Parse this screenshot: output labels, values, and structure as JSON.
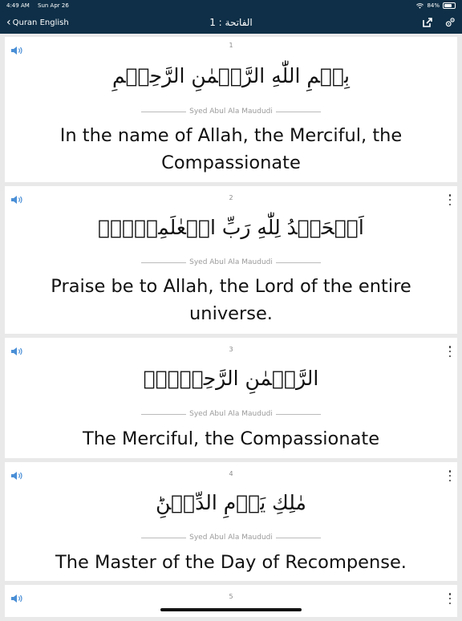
{
  "status": {
    "time": "4:49 AM",
    "date": "Sun Apr 26",
    "battery": "84%"
  },
  "nav": {
    "back_label": "Quran English",
    "title": "الفاتحة : 1"
  },
  "verses": [
    {
      "number": "1",
      "arabic": "بِسۡمِ اللّٰهِ الرَّحۡمٰنِ الرَّحِيۡمِ",
      "translator": "Syed Abul Ala Maududi",
      "translation": "In the name of Allah, the Merciful, the Compassionate"
    },
    {
      "number": "2",
      "arabic": "اَلۡحَمۡدُ لِلّٰهِ رَبِّ الۡعٰلَمِيۡنَۙ",
      "translator": "Syed Abul Ala Maududi",
      "translation": "Praise be to Allah, the Lord of the entire universe."
    },
    {
      "number": "3",
      "arabic": "الرَّحۡمٰنِ الرَّحِيۡمِۙ",
      "translator": "Syed Abul Ala Maududi",
      "translation": "The Merciful, the Compassionate"
    },
    {
      "number": "4",
      "arabic": "مٰلِكِ يَوۡمِ الدِّيۡنِؕ",
      "translator": "Syed Abul Ala Maududi",
      "translation": "The Master of the Day of Recompense."
    },
    {
      "number": "5"
    }
  ],
  "colors": {
    "navbar": "#0e2f47",
    "speaker": "#4a8fd6"
  },
  "icons": {
    "speaker": "speaker-icon",
    "share": "share-icon",
    "settings": "settings-gear-icon",
    "more": "more-vertical-icon",
    "wifi": "wifi-icon",
    "battery": "battery-icon",
    "back": "chevron-left-icon"
  }
}
